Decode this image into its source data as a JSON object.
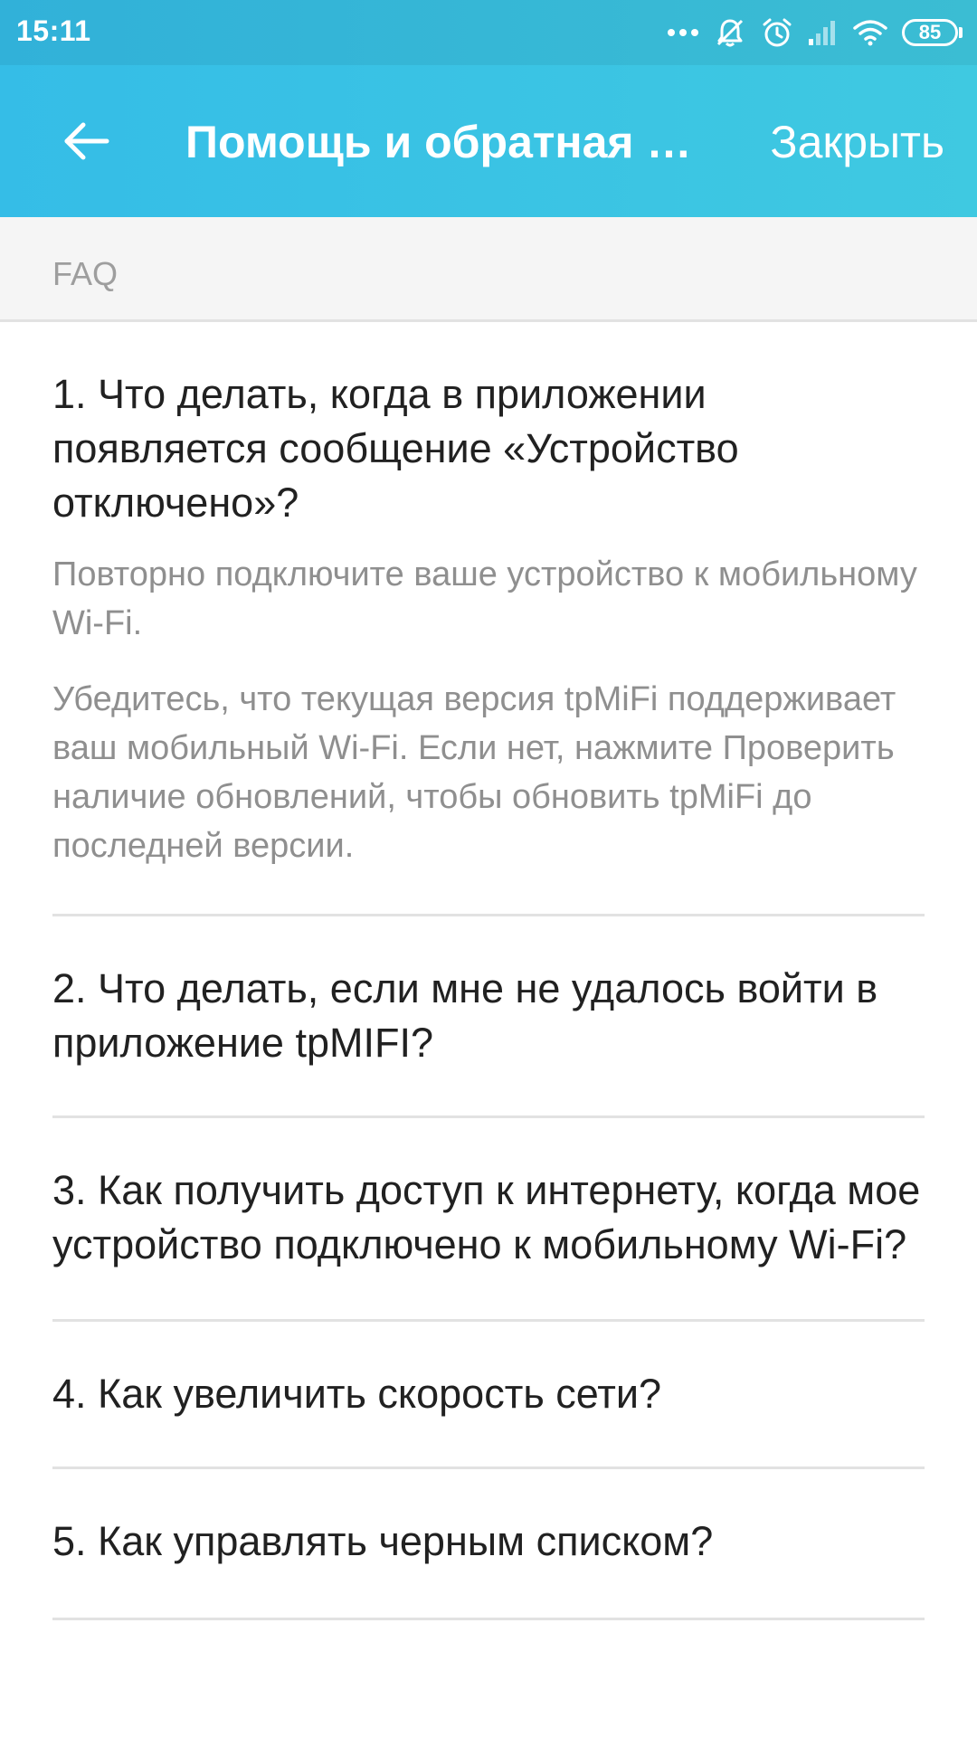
{
  "status_bar": {
    "time": "15:11",
    "battery": "85",
    "icons": [
      "more-dots-icon",
      "mute-notifications-icon",
      "alarm-icon",
      "signal-icon",
      "wifi-icon",
      "battery-icon"
    ]
  },
  "app_bar": {
    "back_icon": "arrow-left-icon",
    "title": "Помощь и обратная связь",
    "close_label": "Закрыть"
  },
  "section": {
    "label": "FAQ"
  },
  "faq": {
    "items": [
      {
        "question": "1. Что делать, когда в приложении появляется сообщение «Устройство отключено»?",
        "answer_p1": "Повторно подключите ваше устройство к мобильному Wi-Fi.",
        "answer_p2": "Убедитесь, что текущая версия tpMiFi поддерживает ваш мобильный Wi-Fi. Если нет, нажмите Проверить наличие обновлений, чтобы обновить tpMiFi до последней версии."
      },
      {
        "question": "2. Что делать, если мне не удалось войти в приложение tpMIFI?"
      },
      {
        "question": "3. Как получить доступ к интернету, когда мое устройство подключено к мобильному Wi-Fi?"
      },
      {
        "question": "4. Как увеличить скорость сети?"
      },
      {
        "question": "5. Как управлять черным списком?"
      }
    ]
  },
  "colors": {
    "accent_start": "#35bde7",
    "accent_end": "#3fc9e1",
    "question_text": "#212121",
    "answer_text": "#8f8f8f",
    "divider": "#e2e2e2"
  }
}
